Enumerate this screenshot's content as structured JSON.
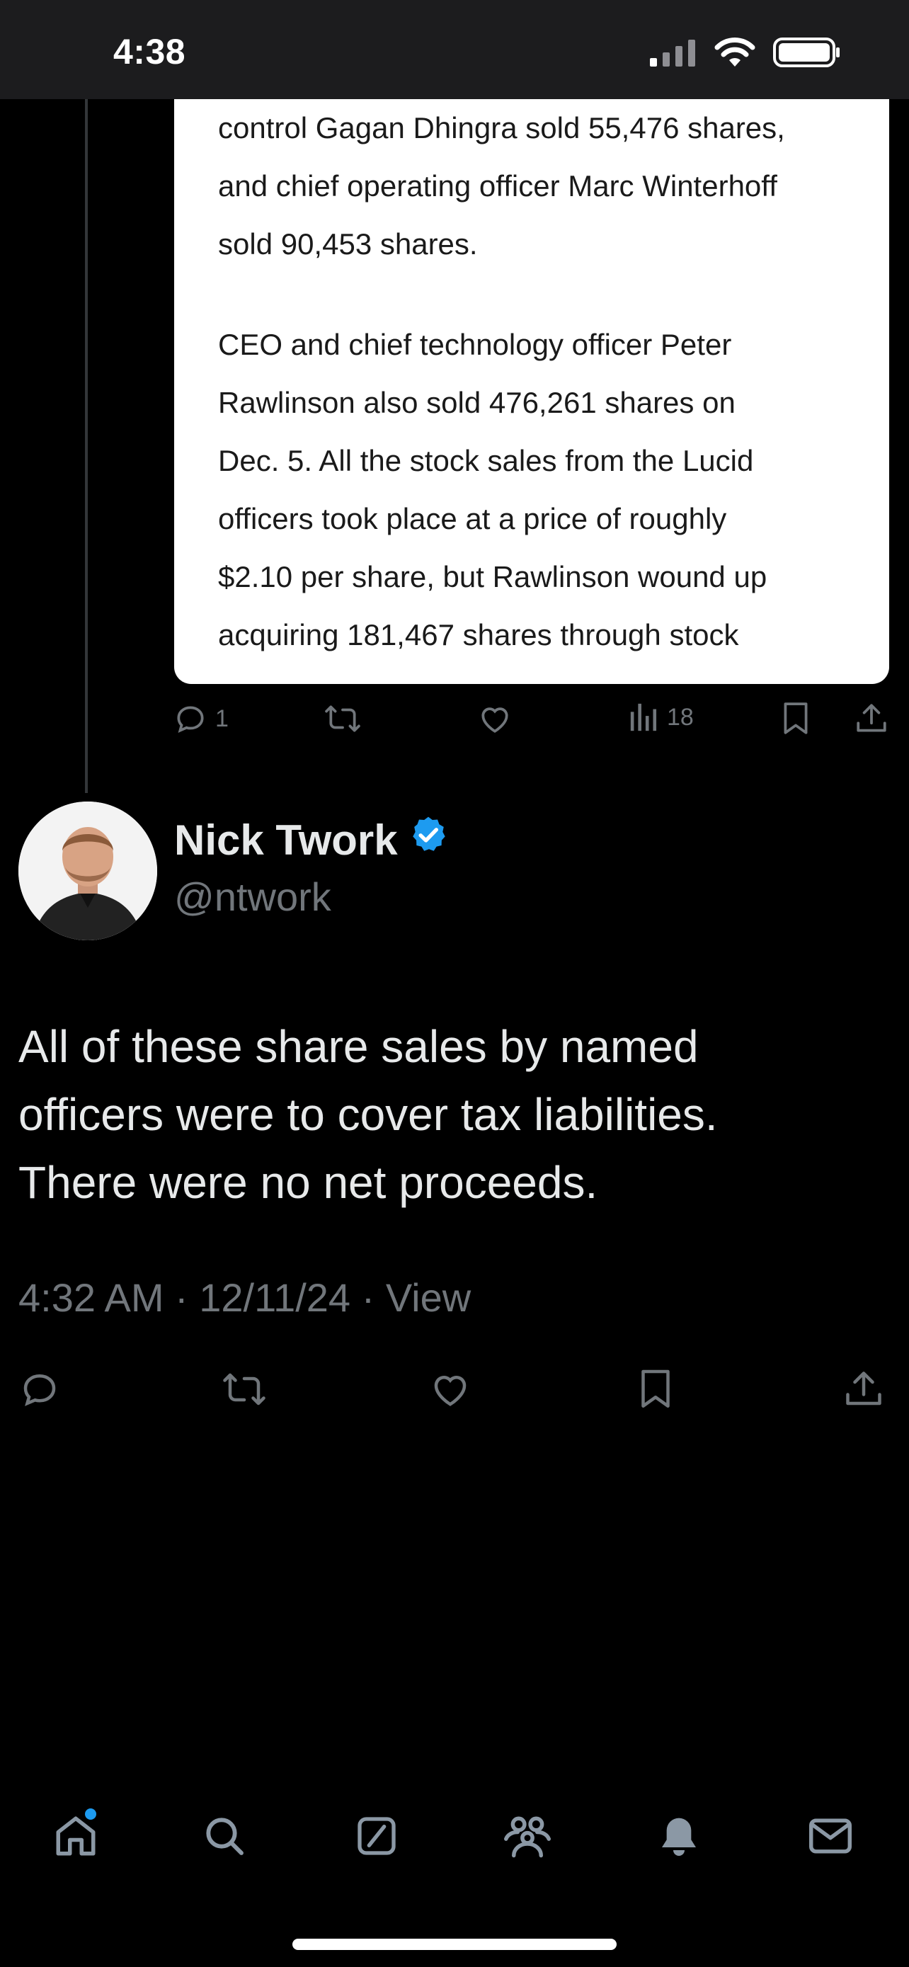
{
  "status_bar": {
    "time": "4:38"
  },
  "quoted_image": {
    "paragraphs": [
      "control Gagan Dhingra sold 55,476 shares,\nand chief operating officer Marc Winterhoff\nsold 90,453 shares.",
      "CEO and chief technology officer Peter\nRawlinson also sold 476,261 shares on\nDec. 5. All the stock sales from the Lucid\nofficers took place at a price of roughly\n$2.10 per share, but Rawlinson wound up\nacquiring 181,467 shares through stock"
    ]
  },
  "parent_actions": {
    "reply_count": "1",
    "views_count": "18"
  },
  "tweet": {
    "author_name": "Nick Twork",
    "author_handle": "@ntwork",
    "text": "All of these share sales by named\nofficers were to cover tax liabilities.\nThere were no net proceeds.",
    "meta": "4:32 AM · 12/11/24 · View"
  },
  "icons": {
    "reply": "reply-icon",
    "retweet": "retweet-icon",
    "like": "heart-icon",
    "views": "views-icon",
    "bookmark": "bookmark-icon",
    "share": "share-icon",
    "verified": "verified-badge-icon"
  },
  "colors": {
    "background": "#000000",
    "text_primary": "#e7e9ea",
    "text_secondary": "#71767b",
    "accent": "#1d9bf0"
  },
  "bottom_nav": [
    "home",
    "search",
    "grok",
    "communities",
    "notifications",
    "messages"
  ]
}
